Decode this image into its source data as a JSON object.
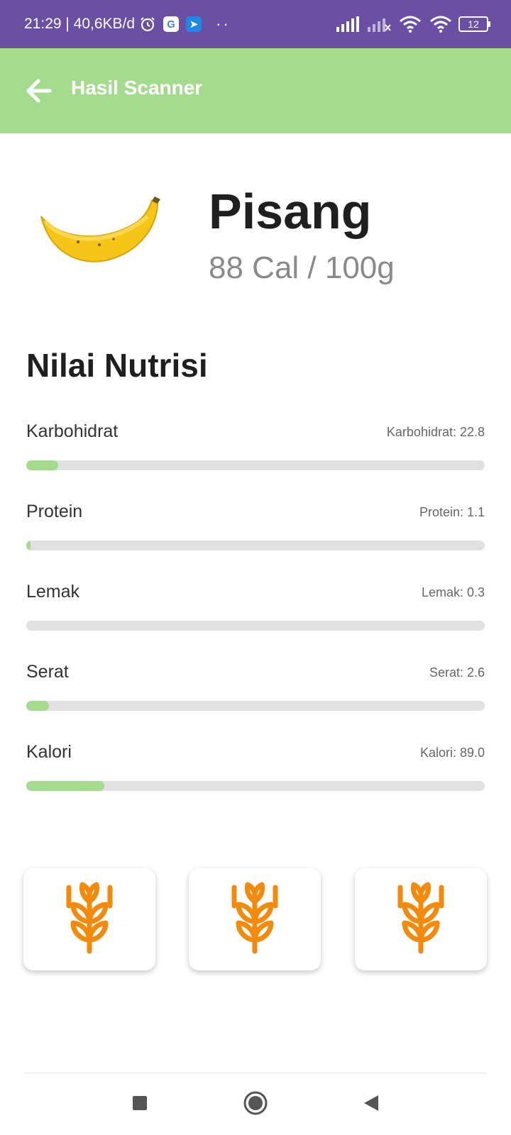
{
  "status_bar": {
    "time_speed": "21:29 | 40,6KB/d",
    "dots": "··",
    "battery": "12"
  },
  "app_bar": {
    "title": "Hasil Scanner",
    "back_icon": "arrow-left-icon"
  },
  "food": {
    "name": "Pisang",
    "calories": "88 Cal / 100g",
    "image_icon": "banana-icon"
  },
  "nutrition": {
    "title": "Nilai Nutrisi",
    "items": [
      {
        "label": "Karbohidrat",
        "value_text": "Karbohidrat: 22.8",
        "fill_fraction": 0.07
      },
      {
        "label": "Protein",
        "value_text": "Protein: 1.1",
        "fill_fraction": 0.01
      },
      {
        "label": "Lemak",
        "value_text": "Lemak: 0.3",
        "fill_fraction": 0.0
      },
      {
        "label": "Serat",
        "value_text": "Serat: 2.6",
        "fill_fraction": 0.05
      },
      {
        "label": "Kalori",
        "value_text": "Kalori: 89.0",
        "fill_fraction": 0.17
      }
    ]
  },
  "cards": [
    {
      "icon": "wheat-icon"
    },
    {
      "icon": "wheat-icon"
    },
    {
      "icon": "wheat-icon"
    }
  ],
  "colors": {
    "status_bar": "#6a4fa3",
    "app_bar": "#a5db8e",
    "progress_fill": "#a5db8e",
    "wheat": "#f28a0c"
  },
  "nav_bar": {
    "icons": [
      "recent-apps-icon",
      "home-icon",
      "back-triangle-icon"
    ]
  }
}
